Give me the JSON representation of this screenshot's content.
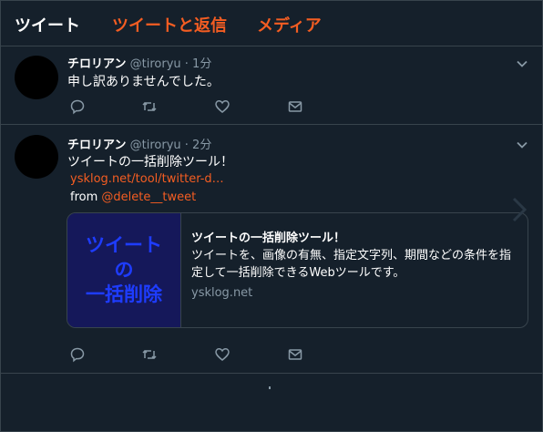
{
  "tabs": [
    "ツイート",
    "ツイートと返信",
    "メディア"
  ],
  "tweets": [
    {
      "name": "チロリアン",
      "handle": "@tiroryu",
      "dot": "·",
      "time": "1分",
      "text": "申し訳ありませんでした。"
    },
    {
      "name": "チロリアン",
      "handle": "@tiroryu",
      "dot": "·",
      "time": "2分",
      "text": "ツイートの一括削除ツール！",
      "link": "ysklog.net/tool/twitter-d…",
      "from_label": "from",
      "mention": "@delete__tweet",
      "card": {
        "image_lines": [
          "ツイート",
          "の",
          "一括削除"
        ],
        "title": "ツイートの一括削除ツール！",
        "description": "ツイートを、画像の有無、指定文字列、期間などの条件を指定して一括削除できるWebツールです。",
        "domain": "ysklog.net"
      }
    }
  ],
  "icons": {
    "reply": "reply-icon",
    "retweet": "retweet-icon",
    "like": "heart-icon",
    "dm": "envelope-icon",
    "menu": "chevron-down-icon"
  },
  "colors": {
    "background": "#15202b",
    "accent": "#f45d22",
    "border": "#38444d",
    "muted": "#8899a6",
    "card_image_bg": "#15185a",
    "card_image_text": "#1e3cff"
  }
}
